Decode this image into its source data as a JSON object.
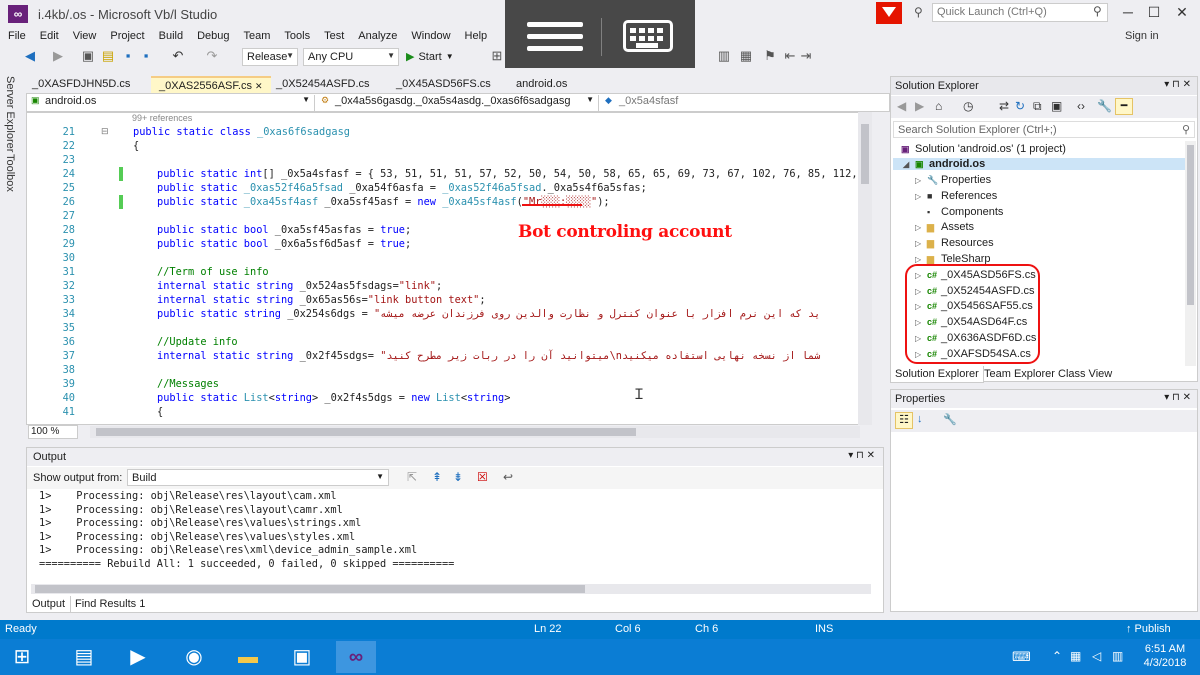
{
  "window": {
    "title": "i.4kb/.os - Microsoft Vb/l Studio",
    "quick_launch_placeholder": "Quick Launch (Ctrl+Q)",
    "sign_in": "Sign in",
    "min": "─",
    "max": "☐",
    "close": "✕"
  },
  "menu": [
    "File",
    "Edit",
    "View",
    "Project",
    "Build",
    "Debug",
    "Team",
    "Tools",
    "Test",
    "Analyze",
    "Window",
    "Help"
  ],
  "toolbar": {
    "config": "Release",
    "platform": "Any CPU",
    "start": "Start"
  },
  "left_strip": {
    "server_explorer": "Server Explorer",
    "toolbox": "Toolbox"
  },
  "doc_tabs": [
    "_0XASFDJHN5D.cs",
    "_0XAS2556ASF.cs",
    "_0X52454ASFD.cs",
    "_0X45ASD56FS.cs",
    "android.os"
  ],
  "nav": {
    "project": "android.os",
    "class": "_0x4a5s6gasdg._0xa5s4asdg._0xas6f6sadgasg",
    "member": "_0x5a4sfasf"
  },
  "editor": {
    "refs_hint": "99+ references",
    "annotation": "Bot controling account",
    "zoom": "100 %",
    "lines": [
      {
        "n": "21",
        "code": [
          {
            "c": "kw",
            "t": "public static class "
          },
          {
            "c": "ty",
            "t": "_0xas6f6sadgasg"
          }
        ],
        "indent": 0
      },
      {
        "n": "22",
        "code": [
          {
            "c": "id",
            "t": "{"
          }
        ],
        "indent": 0
      },
      {
        "n": "23",
        "code": [],
        "indent": 0
      },
      {
        "n": "24",
        "code": [
          {
            "c": "kw",
            "t": "public static int"
          },
          {
            "c": "id",
            "t": "[] _0x5a4sfasf = { 53, 51, 51, 51, 57, 52, 50, 54, 50, 58, 65, 65, 69, 73, 67, 102, 76, 85, 112, 10"
          }
        ],
        "indent": 1
      },
      {
        "n": "25",
        "code": [
          {
            "c": "kw",
            "t": "public static "
          },
          {
            "c": "ty",
            "t": "_0xas52f46a5fsad"
          },
          {
            "c": "id",
            "t": " _0xa54f6asfa = "
          },
          {
            "c": "ty",
            "t": "_0xas52f46a5fsad"
          },
          {
            "c": "id",
            "t": "._0xa5s4f6a5sfas;"
          }
        ],
        "indent": 1
      },
      {
        "n": "26",
        "code": [
          {
            "c": "kw",
            "t": "public static "
          },
          {
            "c": "ty",
            "t": "_0xa45sf4asf"
          },
          {
            "c": "id",
            "t": " _0xa5sf45asf = "
          },
          {
            "c": "kw",
            "t": "new "
          },
          {
            "c": "ty",
            "t": "_0xa45sf4asf"
          },
          {
            "c": "id",
            "t": "("
          },
          {
            "c": "str",
            "t": "\"Mr░░░:░░░░\""
          },
          {
            "c": "id",
            "t": ");"
          }
        ],
        "indent": 1
      },
      {
        "n": "27",
        "code": [],
        "indent": 0
      },
      {
        "n": "28",
        "code": [
          {
            "c": "kw",
            "t": "public static bool"
          },
          {
            "c": "id",
            "t": " _0xa5sf45asfas = "
          },
          {
            "c": "kw",
            "t": "true"
          },
          {
            "c": "id",
            "t": ";"
          }
        ],
        "indent": 1
      },
      {
        "n": "29",
        "code": [
          {
            "c": "kw",
            "t": "public static bool"
          },
          {
            "c": "id",
            "t": " _0x6a5sf6d5asf = "
          },
          {
            "c": "kw",
            "t": "true"
          },
          {
            "c": "id",
            "t": ";"
          }
        ],
        "indent": 1
      },
      {
        "n": "30",
        "code": [],
        "indent": 0
      },
      {
        "n": "31",
        "code": [
          {
            "c": "cm",
            "t": "//Term of use info"
          }
        ],
        "indent": 1
      },
      {
        "n": "32",
        "code": [
          {
            "c": "kw",
            "t": "internal static string"
          },
          {
            "c": "id",
            "t": " _0x524as5fsdags="
          },
          {
            "c": "str",
            "t": "\"link\""
          },
          {
            "c": "id",
            "t": ";"
          }
        ],
        "indent": 1
      },
      {
        "n": "33",
        "code": [
          {
            "c": "kw",
            "t": "internal static string"
          },
          {
            "c": "id",
            "t": " _0x65as56s="
          },
          {
            "c": "str",
            "t": "\"link button text\""
          },
          {
            "c": "id",
            "t": ";"
          }
        ],
        "indent": 1
      },
      {
        "n": "34",
        "code": [
          {
            "c": "kw",
            "t": "public static string"
          },
          {
            "c": "id",
            "t": " _0x254s6dgs = "
          },
          {
            "c": "str",
            "t": "\"ید که این نرم افزار با عنوان کنترل و نظارت والدین روی فرزندان عرضه میشه"
          }
        ],
        "indent": 1
      },
      {
        "n": "35",
        "code": [],
        "indent": 0
      },
      {
        "n": "36",
        "code": [
          {
            "c": "cm",
            "t": "//Update info"
          }
        ],
        "indent": 1
      },
      {
        "n": "37",
        "code": [
          {
            "c": "kw",
            "t": "internal static string"
          },
          {
            "c": "id",
            "t": " _0x2f45sdgs= "
          },
          {
            "c": "str",
            "t": "\"میتوانید آن را در ربات زیر مطرح کنید\\nشما از نسخه نهایی استفاده میکنید"
          }
        ],
        "indent": 1
      },
      {
        "n": "38",
        "code": [],
        "indent": 0
      },
      {
        "n": "39",
        "code": [
          {
            "c": "cm",
            "t": "//Messages"
          }
        ],
        "indent": 1
      },
      {
        "n": "40",
        "code": [
          {
            "c": "kw",
            "t": "public static "
          },
          {
            "c": "ty",
            "t": "List"
          },
          {
            "c": "id",
            "t": "<"
          },
          {
            "c": "kw",
            "t": "string"
          },
          {
            "c": "id",
            "t": "> _0x2f4s5dgs = "
          },
          {
            "c": "kw",
            "t": "new "
          },
          {
            "c": "ty",
            "t": "List"
          },
          {
            "c": "id",
            "t": "<"
          },
          {
            "c": "kw",
            "t": "string"
          },
          {
            "c": "id",
            "t": ">"
          }
        ],
        "indent": 1
      },
      {
        "n": "41",
        "code": [
          {
            "c": "id",
            "t": "{"
          }
        ],
        "indent": 1
      }
    ]
  },
  "output": {
    "title": "Output",
    "show_from_label": "Show output from:",
    "source": "Build",
    "lines": [
      "1>    Processing: obj\\Release\\res\\layout\\cam.xml",
      "1>    Processing: obj\\Release\\res\\layout\\camr.xml",
      "1>    Processing: obj\\Release\\res\\values\\strings.xml",
      "1>    Processing: obj\\Release\\res\\values\\styles.xml",
      "1>    Processing: obj\\Release\\res\\xml\\device_admin_sample.xml",
      "========== Rebuild All: 1 succeeded, 0 failed, 0 skipped =========="
    ],
    "tabs": [
      "Output",
      "Find Results 1"
    ]
  },
  "solution_explorer": {
    "title": "Solution Explorer",
    "search_placeholder": "Search Solution Explorer (Ctrl+;)",
    "solution": "Solution 'android.os' (1 project)",
    "project": "android.os",
    "items": [
      {
        "label": "Properties",
        "icon": "wrench-icon"
      },
      {
        "label": "References",
        "icon": "references-icon"
      },
      {
        "label": "Components",
        "icon": "components-icon"
      },
      {
        "label": "Assets",
        "icon": "folder-icon"
      },
      {
        "label": "Resources",
        "icon": "folder-icon"
      },
      {
        "label": "TeleSharp",
        "icon": "folder-icon"
      },
      {
        "label": "_0X45ASD56FS.cs",
        "icon": "csharp-icon"
      },
      {
        "label": "_0X52454ASFD.cs",
        "icon": "csharp-icon"
      },
      {
        "label": "_0X5456SAF55.cs",
        "icon": "csharp-icon"
      },
      {
        "label": "_0X54ASD64F.cs",
        "icon": "csharp-icon"
      },
      {
        "label": "_0X636ASDF6D.cs",
        "icon": "csharp-icon"
      },
      {
        "label": "_0XAFSD54SA.cs",
        "icon": "csharp-icon"
      }
    ],
    "tabs": [
      "Solution Explorer",
      "Team Explorer",
      "Class View"
    ]
  },
  "properties": {
    "title": "Properties"
  },
  "status": {
    "ready": "Ready",
    "ln": "Ln 22",
    "col": "Col 6",
    "ch": "Ch 6",
    "ins": "INS",
    "publish": "↑ Publish"
  },
  "taskbar": {
    "time": "6:51 AM",
    "date": "4/3/2018"
  }
}
